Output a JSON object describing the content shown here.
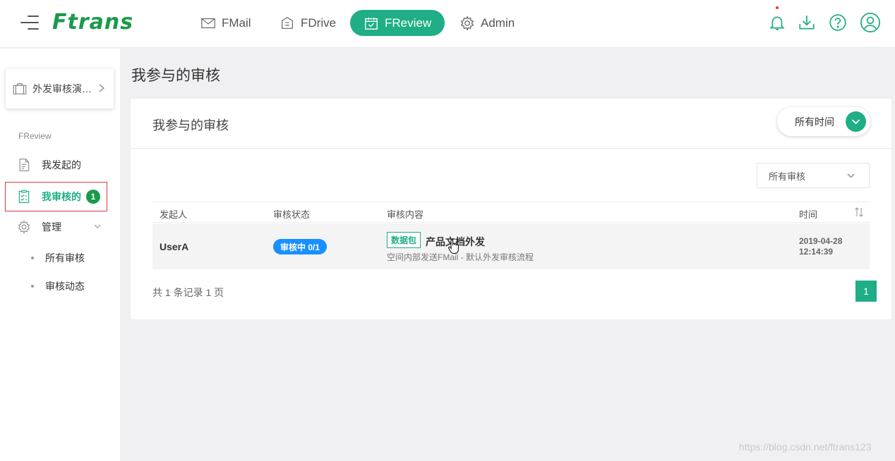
{
  "header": {
    "logo": "Ftrans",
    "tabs": [
      {
        "label": "FMail",
        "icon": "mail-icon"
      },
      {
        "label": "FDrive",
        "icon": "drive-icon"
      },
      {
        "label": "FReview",
        "icon": "calendar-check-icon",
        "active": true
      },
      {
        "label": "Admin",
        "icon": "gear-icon"
      }
    ],
    "actions": [
      "bell-icon",
      "download-icon",
      "help-icon",
      "user-icon"
    ]
  },
  "sidebar": {
    "project": "外发审核演…",
    "section": "FReview",
    "items": [
      {
        "label": "我发起的",
        "icon": "document-icon"
      },
      {
        "label": "我审核的",
        "icon": "clipboard-check-icon",
        "badge": "1",
        "active": true
      },
      {
        "label": "管理",
        "icon": "gear-icon"
      }
    ],
    "sub_items": [
      "所有审核",
      "审核动态"
    ]
  },
  "main": {
    "page_title": "我参与的审核",
    "card_title": "我参与的审核",
    "time_filter": "所有时间",
    "review_filter": "所有审核",
    "table": {
      "headers": [
        "发起人",
        "审核状态",
        "审核内容",
        "时间"
      ],
      "rows": [
        {
          "initiator": "UserA",
          "status": "审核中 0/1",
          "tag": "数据包",
          "title": "产品文档外发",
          "subtitle": "空间内部发送FMail - 默认外发审核流程",
          "date": "2019-04-28",
          "time": "12:14:39"
        }
      ]
    },
    "footer": "共 1 条记录 1 页",
    "page": "1"
  },
  "watermark": "https://blog.csdn.net/ftrans123",
  "colors": {
    "brand": "#1a9a4a",
    "accent": "#1fae85",
    "status_blue": "#1890ff",
    "highlight_frame": "#e0383e"
  }
}
